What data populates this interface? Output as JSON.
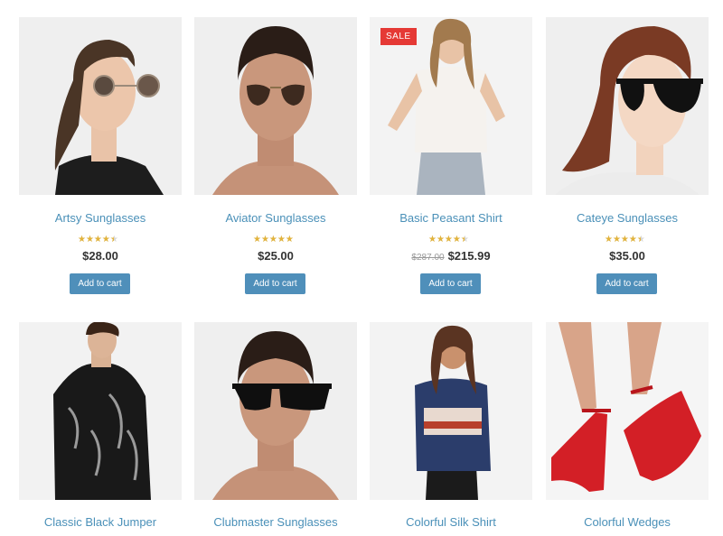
{
  "products": [
    {
      "name": "Artsy Sunglasses",
      "rating": 4,
      "rating_max": 5,
      "price": "$28.00",
      "cart_label": "Add to cart"
    },
    {
      "name": "Aviator Sunglasses",
      "rating": 4.5,
      "rating_max": 5,
      "price": "$25.00",
      "cart_label": "Add to cart"
    },
    {
      "name": "Basic Peasant Shirt",
      "badge": "SALE",
      "rating": 4,
      "rating_max": 5,
      "old_price": "$287.00",
      "price": "$215.99",
      "cart_label": "Add to cart"
    },
    {
      "name": "Cateye Sunglasses",
      "rating": 4,
      "rating_max": 5,
      "price": "$35.00",
      "cart_label": "Add to cart"
    },
    {
      "name": "Classic Black Jumper"
    },
    {
      "name": "Clubmaster Sunglasses"
    },
    {
      "name": "Colorful Silk Shirt"
    },
    {
      "name": "Colorful Wedges"
    }
  ],
  "colors": {
    "link": "#4a90b8",
    "button": "#4f8fba",
    "sale_badge": "#e53935",
    "star": "#e2b33b"
  },
  "star_glyph": "★★★★★"
}
